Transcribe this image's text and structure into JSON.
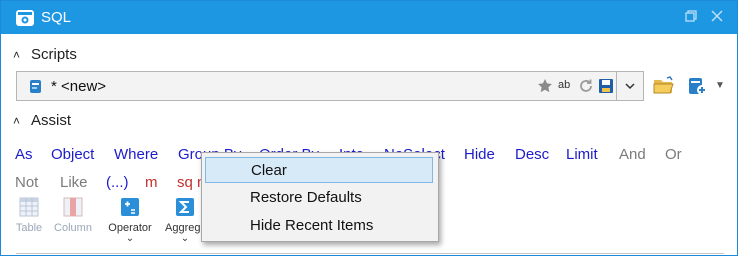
{
  "window": {
    "title": "SQL"
  },
  "scripts": {
    "header": "Scripts",
    "combo_value": "* <new>",
    "ab_icon_text": "ab"
  },
  "assist": {
    "header": "Assist",
    "row1": [
      "As",
      "Object",
      "Where",
      "Group By",
      "Order By",
      "Into",
      "NoSelect",
      "Hide",
      "Desc",
      "Limit",
      "And",
      "Or"
    ],
    "row2": [
      "Not",
      "Like",
      "(...)",
      "m",
      "sq n"
    ],
    "buttons": [
      {
        "label": "Table"
      },
      {
        "label": "Column"
      },
      {
        "label": "Operator"
      },
      {
        "label": "Aggreg"
      }
    ]
  },
  "context_menu": {
    "items": [
      "Clear",
      "Restore Defaults",
      "Hide Recent Items"
    ]
  },
  "colors": {
    "titlebar": "#1e97e3",
    "keyword_blue": "#1c1ccc",
    "keyword_gray": "#7b7b7b",
    "keyword_red": "#c0322e",
    "menu_highlight": "#d7eaf8"
  }
}
